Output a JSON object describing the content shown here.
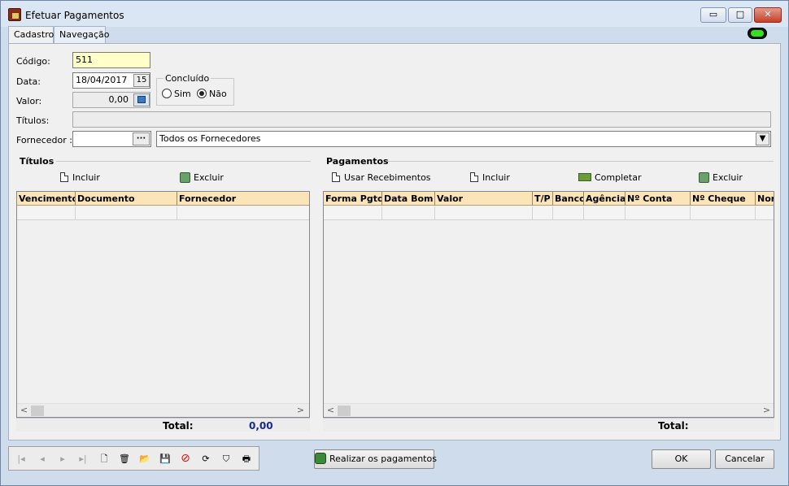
{
  "window": {
    "title": "Efetuar Pagamentos",
    "minimize_glyph": "▭",
    "maximize_glyph": "□",
    "close_glyph": "✕"
  },
  "tabs": [
    {
      "label": "Cadastro",
      "active": true
    },
    {
      "label": "Navegação",
      "active": false
    }
  ],
  "status_indicator_color": "#35e020",
  "form": {
    "codigo_label": "Código:",
    "codigo_value": "511",
    "data_label": "Data:",
    "data_value": "18/04/2017",
    "calendar_icon_glyph": "15",
    "valor_label": "Valor:",
    "valor_value": "0,00",
    "concluido_label": "Concluído",
    "concluido_options": [
      {
        "label": "Sim",
        "selected": false
      },
      {
        "label": "Não",
        "selected": true
      }
    ],
    "titulos_label": "Títulos:",
    "titulos_value": "",
    "fornecedor_label": "Fornecedor :",
    "fornecedor_code": "",
    "fornecedor_lookup_glyph": "···",
    "fornecedor_selected": "Todos os Fornecedores",
    "dropdown_glyph": "▼"
  },
  "titulos_section": {
    "title": "Títulos",
    "incluir_label": "Incluir",
    "excluir_label": "Excluir",
    "columns": [
      "Vencimento",
      "Documento",
      "Fornecedor"
    ],
    "rows": [],
    "total_label": "Total:",
    "total_value": "0,00"
  },
  "pagamentos_section": {
    "title": "Pagamentos",
    "usar_recebimentos_label": "Usar Recebimentos",
    "incluir_label": "Incluir",
    "completar_label": "Completar",
    "excluir_label": "Excluir",
    "columns": [
      "Forma Pgto",
      "Data Bom",
      "Valor",
      "T/P",
      "Banco",
      "Agência",
      "Nº Conta",
      "Nº Cheque",
      "Nor"
    ],
    "rows": [],
    "total_label": "Total:",
    "total_value": ""
  },
  "scroll_left_glyph": "<",
  "scroll_right_glyph": ">",
  "navigator": {
    "first": "|◂",
    "prev": "◂",
    "next": "▸",
    "last": "▸|",
    "new": "🗋",
    "delete": "🗑",
    "open": "📂",
    "save": "💾",
    "cancel": "⊘",
    "refresh": "⟳",
    "filter": "⛉",
    "print": "🖶"
  },
  "buttons": {
    "realizar_label": "Realizar os pagamentos",
    "ok_label": "OK",
    "cancelar_label": "Cancelar"
  }
}
